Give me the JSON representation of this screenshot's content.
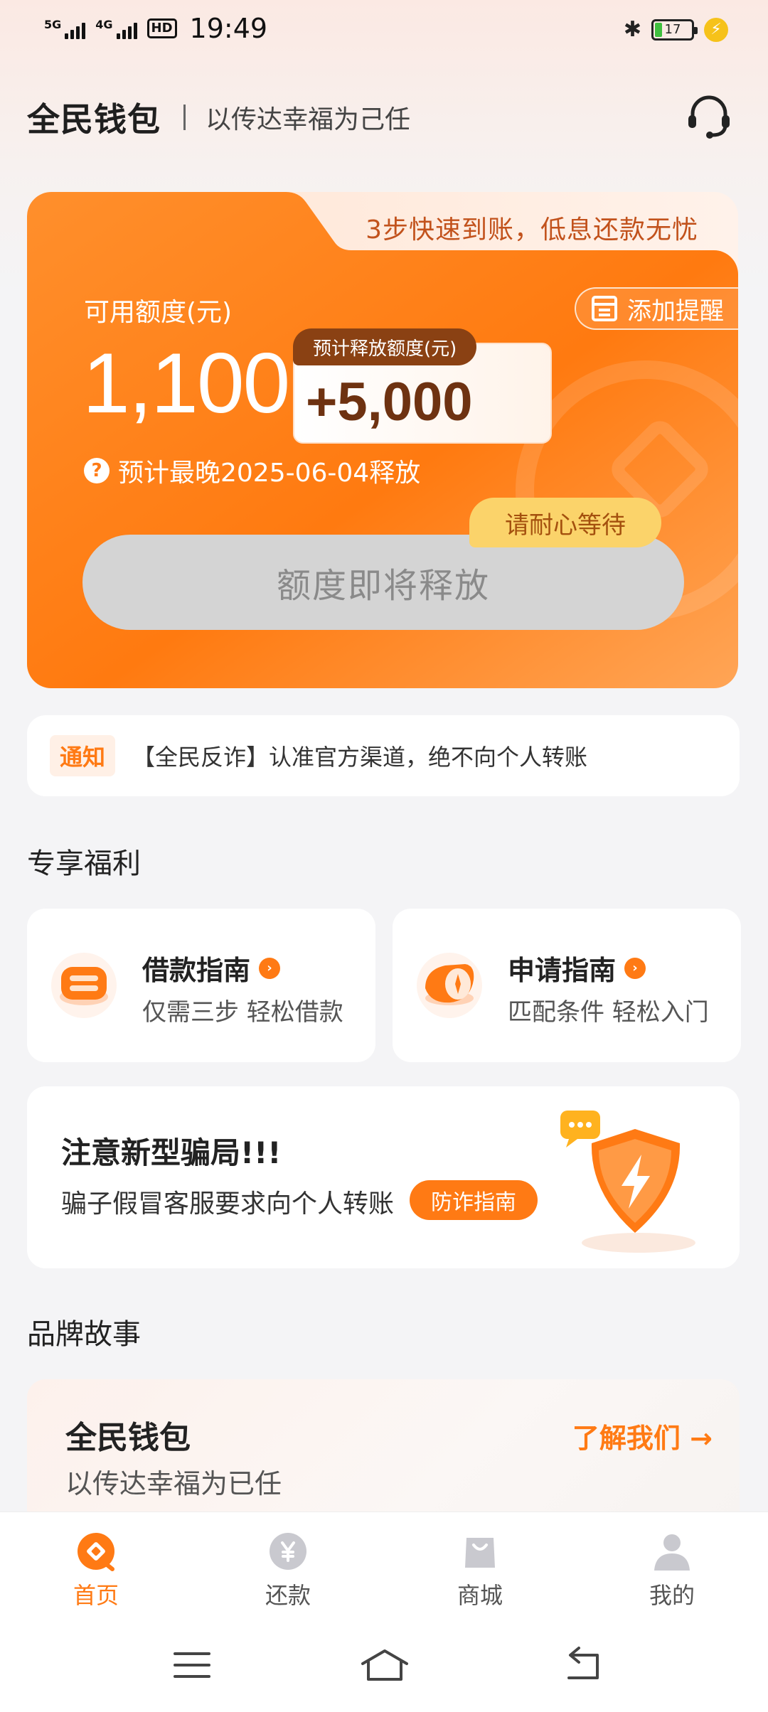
{
  "status_bar": {
    "time": "19:49",
    "signal1": "5G",
    "signal2": "4G",
    "hd": "HD",
    "battery": "17",
    "bluetooth_icon": "bluetooth-icon",
    "charging_icon": "charging-icon"
  },
  "header": {
    "brand": "全民钱包",
    "slogan": "以传达幸福为己任",
    "service_icon": "headset-icon"
  },
  "card": {
    "tagline": "3步快速到账，低息还款无忧",
    "available_label": "可用额度(元)",
    "available_amount": "1,100",
    "remind_label": "添加提醒",
    "release_tag": "预计释放额度(元)",
    "release_amount": "+5,000",
    "latest_release": "预计最晚2025-06-04释放",
    "wait_tip": "请耐心等待",
    "main_button": "额度即将释放",
    "colors": {
      "primary": "#ff7a14",
      "dark": "#8a4113",
      "bubble": "#fbd36a"
    }
  },
  "notice": {
    "tag": "通知",
    "text": "【全民反诈】认准官方渠道，绝不向个人转账"
  },
  "benefits": {
    "title": "专享福利",
    "items": [
      {
        "title": "借款指南",
        "subtitle": "仅需三步 轻松借款",
        "icon": "loan-guide-icon"
      },
      {
        "title": "申请指南",
        "subtitle": "匹配条件 轻松入门",
        "icon": "apply-guide-icon"
      }
    ]
  },
  "fraud": {
    "title": "注意新型骗局!!!",
    "subtitle": "骗子假冒客服要求向个人转账",
    "button": "防诈指南",
    "icon": "shield-icon"
  },
  "story": {
    "section_title": "品牌故事",
    "title": "全民钱包",
    "subtitle": "以传达幸福为已任",
    "link": "了解我们 →"
  },
  "bottom_nav": [
    {
      "label": "首页",
      "icon": "home-icon",
      "active": true
    },
    {
      "label": "还款",
      "icon": "repay-icon",
      "active": false
    },
    {
      "label": "商城",
      "icon": "shop-icon",
      "active": false
    },
    {
      "label": "我的",
      "icon": "profile-icon",
      "active": false
    }
  ]
}
